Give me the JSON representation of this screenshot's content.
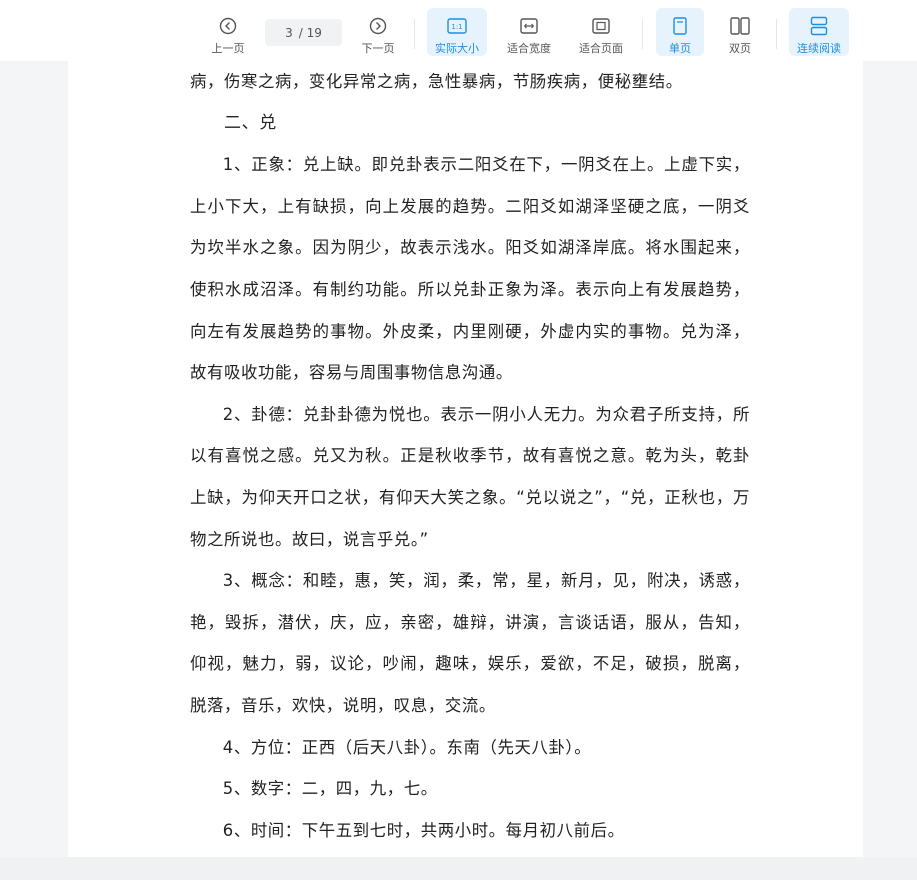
{
  "toolbar": {
    "prev_label": "上一页",
    "next_label": "下一页",
    "page_current": "3",
    "page_total": "/ 19",
    "actual_size_label": "实际大小",
    "fit_width_label": "适合宽度",
    "fit_page_label": "适合页面",
    "single_page_label": "单页",
    "double_page_label": "双页",
    "continuous_label": "连续阅读",
    "actual_size_icon_text": "1:1",
    "accent_color": "#1f8ede"
  },
  "doc": {
    "line0": "病，伤寒之病，变化异常之病，急性暴病，节肠疾病，便秘壅结。",
    "heading": "二、兑",
    "p1": "1、正象：兑上缺。即兑卦表示二阳爻在下，一阴爻在上。上虚下实，上小下大，上有缺损，向上发展的趋势。二阳爻如湖泽坚硬之底，一阴爻为坎半水之象。因为阴少，故表示浅水。阳爻如湖泽岸底。将水围起来，使积水成沼泽。有制约功能。所以兑卦正象为泽。表示向上有发展趋势，向左有发展趋势的事物。外皮柔，内里刚硬，外虚内实的事物。兑为泽，故有吸收功能，容易与周围事物信息沟通。",
    "p2": "2、卦德：兑卦卦德为悦也。表示一阴小人无力。为众君子所支持，所以有喜悦之感。兑又为秋。正是秋收季节，故有喜悦之意。乾为头，乾卦上缺，为仰天开口之状，有仰天大笑之象。“兑以说之”，“兑，正秋也，万物之所说也。故曰，说言乎兑。”",
    "p3": "3、概念：和睦，惠，笑，润，柔，常，星，新月，见，附决，诱惑，艳，毁拆，潜伏，庆，应，亲密，雄辩，讲演，言谈话语，服从，告知，仰视，魅力，弱，议论，吵闹，趣味，娱乐，爱欲，不足，破损，脱离，脱落，音乐，欢快，说明，叹息，交流。",
    "p4": "4、方位：正西（后天八卦）。东南（先天八卦）。",
    "p5": "5、数字：二，四，九，七。",
    "p6": "6、时间：下午五到七时，共两小时。每月初八前后。"
  }
}
